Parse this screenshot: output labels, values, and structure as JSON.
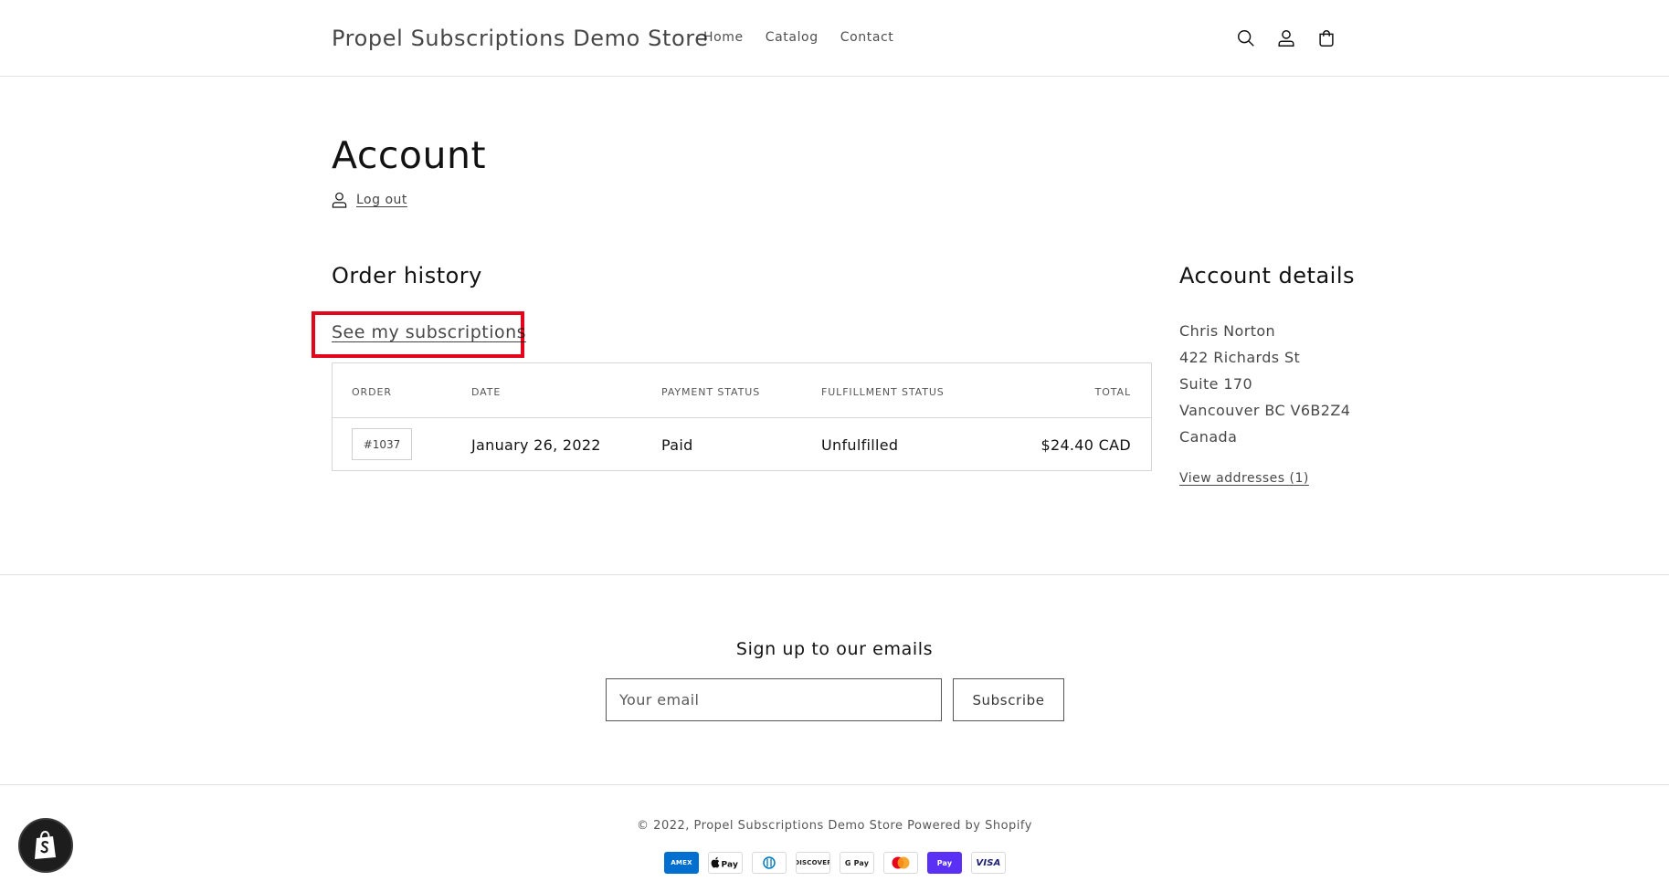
{
  "header": {
    "store_title": "Propel Subscriptions Demo Store",
    "nav": [
      {
        "label": "Home"
      },
      {
        "label": "Catalog"
      },
      {
        "label": "Contact"
      }
    ],
    "icons": [
      "search-icon",
      "account-icon",
      "cart-icon"
    ]
  },
  "account": {
    "title": "Account",
    "logout_label": "Log out"
  },
  "order_history": {
    "title": "Order history",
    "subscriptions_link": "See my subscriptions",
    "highlight_color": "#e3051b",
    "columns": [
      "ORDER",
      "DATE",
      "PAYMENT STATUS",
      "FULFILLMENT STATUS",
      "TOTAL"
    ],
    "rows": [
      {
        "order": "#1037",
        "date": "January 26, 2022",
        "payment_status": "Paid",
        "fulfillment_status": "Unfulfilled",
        "total": "$24.40 CAD"
      }
    ]
  },
  "account_details": {
    "title": "Account details",
    "address_lines": [
      "Chris Norton",
      "422 Richards St",
      "Suite 170",
      "Vancouver BC V6B2Z4",
      "Canada"
    ],
    "view_addresses_label": "View addresses (1)"
  },
  "footer": {
    "signup_title": "Sign up to our emails",
    "email_placeholder": "Your email",
    "subscribe_label": "Subscribe",
    "copyright_prefix": "© 2022,",
    "copyright_store": "Propel Subscriptions Demo Store",
    "powered_by": "Powered by Shopify",
    "payment_methods": {
      "amex": "AMEX",
      "discover": "DISCOVER",
      "google_pay": "G Pay",
      "shop_pay": "Pay",
      "visa": "VISA"
    }
  }
}
